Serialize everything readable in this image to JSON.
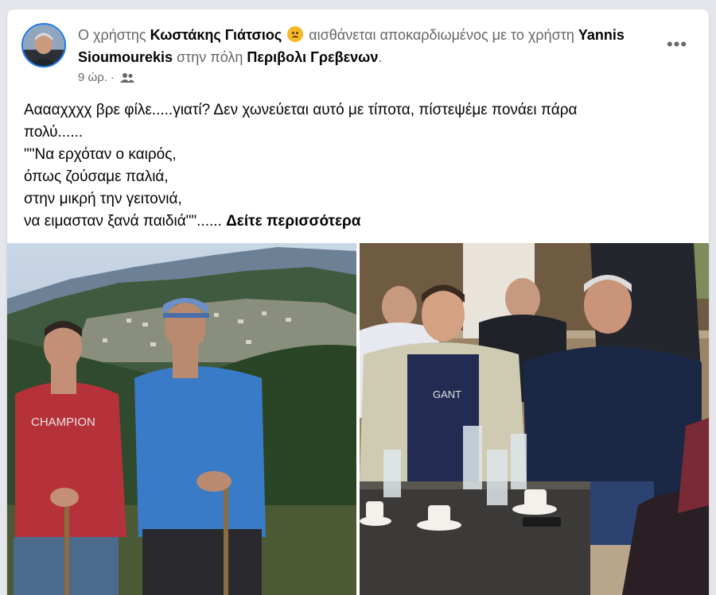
{
  "post": {
    "headline_prefix": "Ο χρήστης",
    "author": "Κωστάκης Γιάτσιος",
    "feeling": "αισθάνεται αποκαρδιωμένος με το χρήστη",
    "tagged_user": "Yannis Sioumourekis",
    "location_prefix": "στην πόλη",
    "location": "Περιβολι Γρεβενων",
    "location_suffix": ".",
    "time": "9 ώρ.",
    "separator": "·",
    "audience_icon": "friends-icon",
    "more_icon": "more-options-icon",
    "more_label": "•••",
    "text_lines": [
      "Ααααχχχχ βρε φίλε.....γιατί? Δεν χωνεύεται αυτό με τίποτα, πίστεψέμε πονάει πάρα",
      "πολύ......",
      "\"\"Να ερχόταν ο καιρός,",
      "όπως ζούσαμε παλιά,",
      "στην μικρή την γειτονιά,",
      "να ειμασταν ξανά παιδιά\"\"......"
    ],
    "see_more": "Δείτε περισσότερα"
  },
  "photos": {
    "left_shirt_text": "CHAMPION",
    "right_shirt_text": "GANT"
  },
  "colors": {
    "accent": "#1877f2",
    "secondary_text": "#65676b",
    "background": "#e4e6eb"
  }
}
